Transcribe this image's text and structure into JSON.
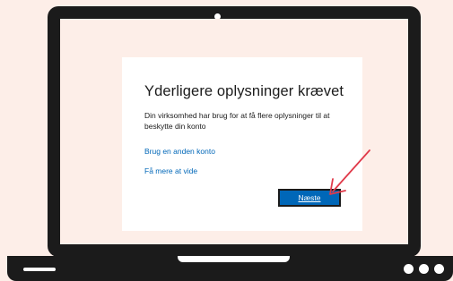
{
  "dialog": {
    "title": "Yderligere oplysninger krævet",
    "description": "Din virksomhed har brug for at få flere oplysninger til at beskytte din konto",
    "link_other_account": "Brug en anden konto",
    "link_learn_more": "Få mere at vide",
    "next_button": "Næste"
  },
  "colors": {
    "background": "#fdeee8",
    "laptop": "#1b1b1b",
    "button": "#0067b8",
    "link": "#0067b8",
    "arrow": "#e03a4a"
  },
  "icons": {
    "arrow": "pointer-arrow-icon"
  }
}
